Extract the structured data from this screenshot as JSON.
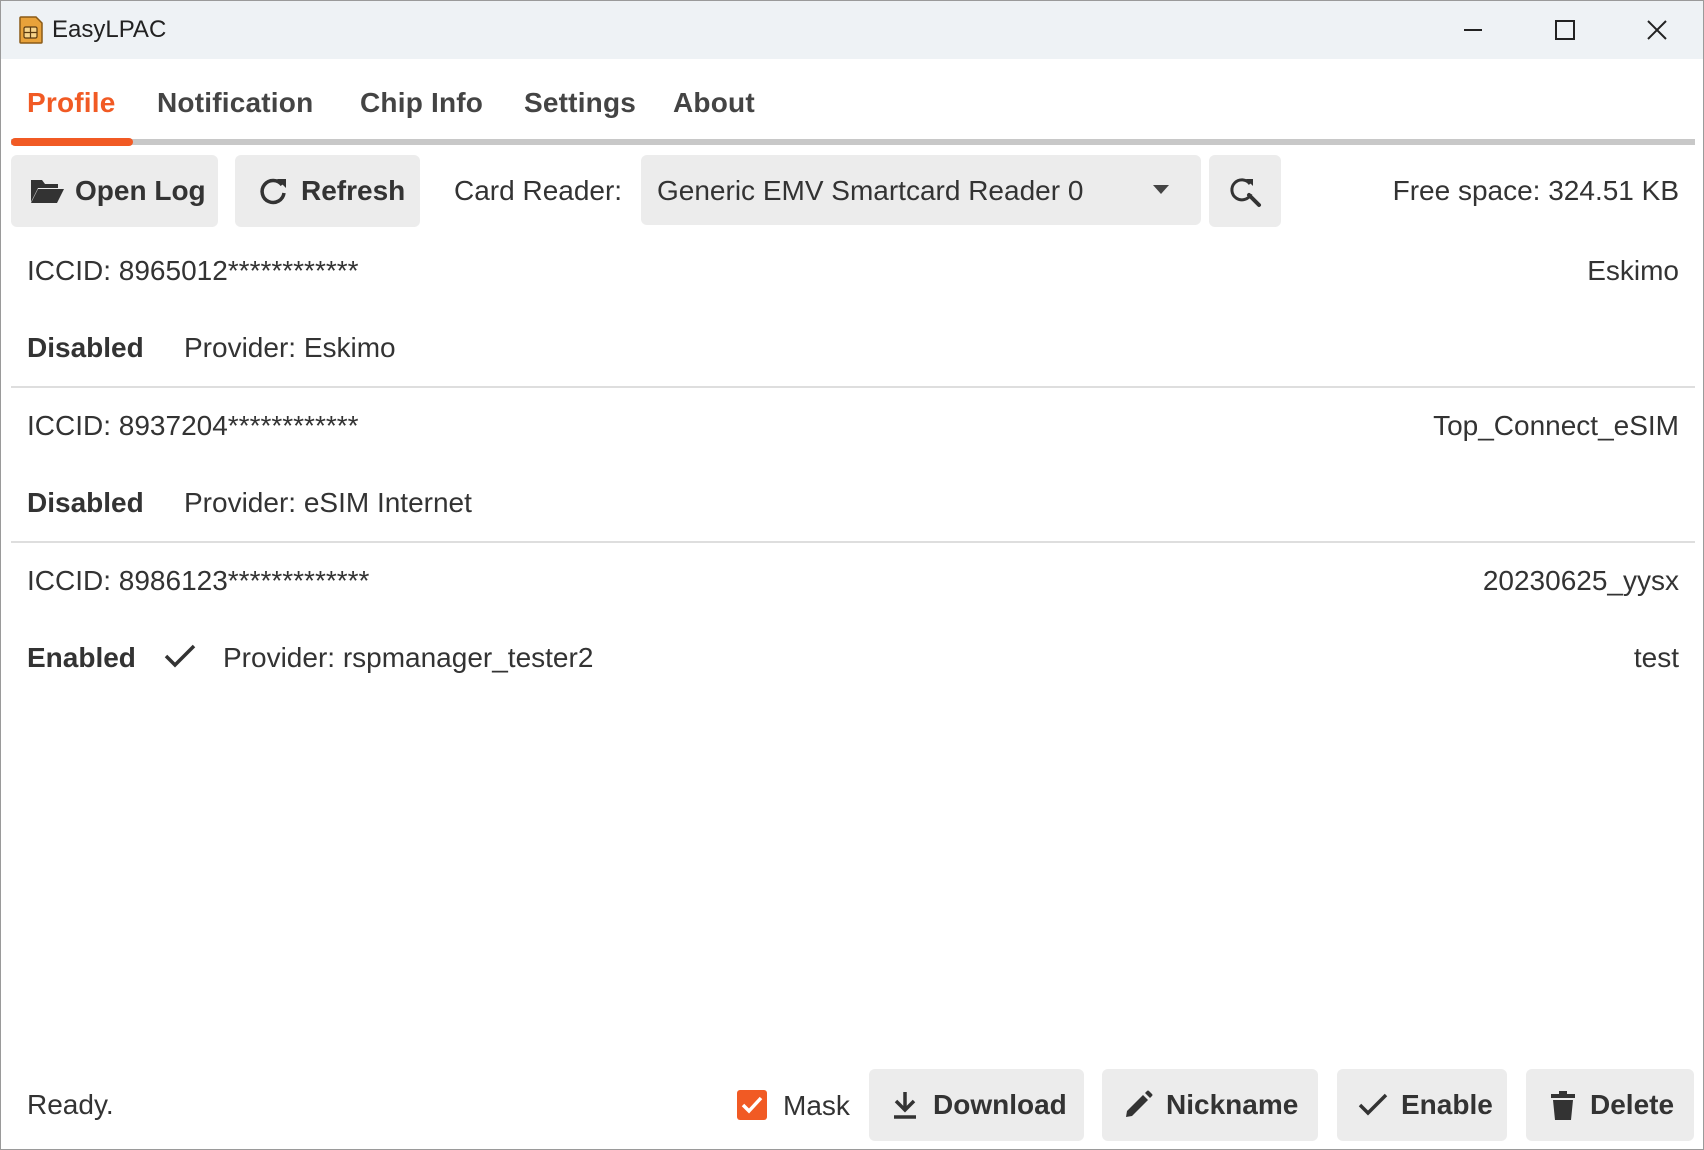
{
  "window": {
    "title": "EasyLPAC"
  },
  "tabs": [
    {
      "label": "Profile",
      "active": true
    },
    {
      "label": "Notification"
    },
    {
      "label": "Chip Info"
    },
    {
      "label": "Settings"
    },
    {
      "label": "About"
    }
  ],
  "toolbar": {
    "open_log_label": "Open Log",
    "refresh_label": "Refresh",
    "card_reader_label": "Card Reader:",
    "card_reader_value": "Generic EMV Smartcard Reader 0",
    "free_space": "Free space: 324.51 KB"
  },
  "profiles": [
    {
      "iccid": "ICCID: 8965012************",
      "name": "Eskimo",
      "state": "Disabled",
      "provider": "Provider: Eskimo",
      "nickname": ""
    },
    {
      "iccid": "ICCID: 8937204************",
      "name": "Top_Connect_eSIM",
      "state": "Disabled",
      "provider": "Provider: eSIM Internet",
      "nickname": ""
    },
    {
      "iccid": "ICCID: 8986123*************",
      "name": "20230625_yysx",
      "state": "Enabled",
      "provider": "Provider: rspmanager_tester2",
      "nickname": "test"
    }
  ],
  "bottom": {
    "status": "Ready.",
    "mask_label": "Mask",
    "mask_checked": true,
    "download_label": "Download",
    "nickname_label": "Nickname",
    "enable_label": "Enable",
    "delete_label": "Delete"
  },
  "colors": {
    "accent": "#f15a24",
    "button_bg": "#ececec",
    "titlebar_bg": "#eef2f5"
  }
}
